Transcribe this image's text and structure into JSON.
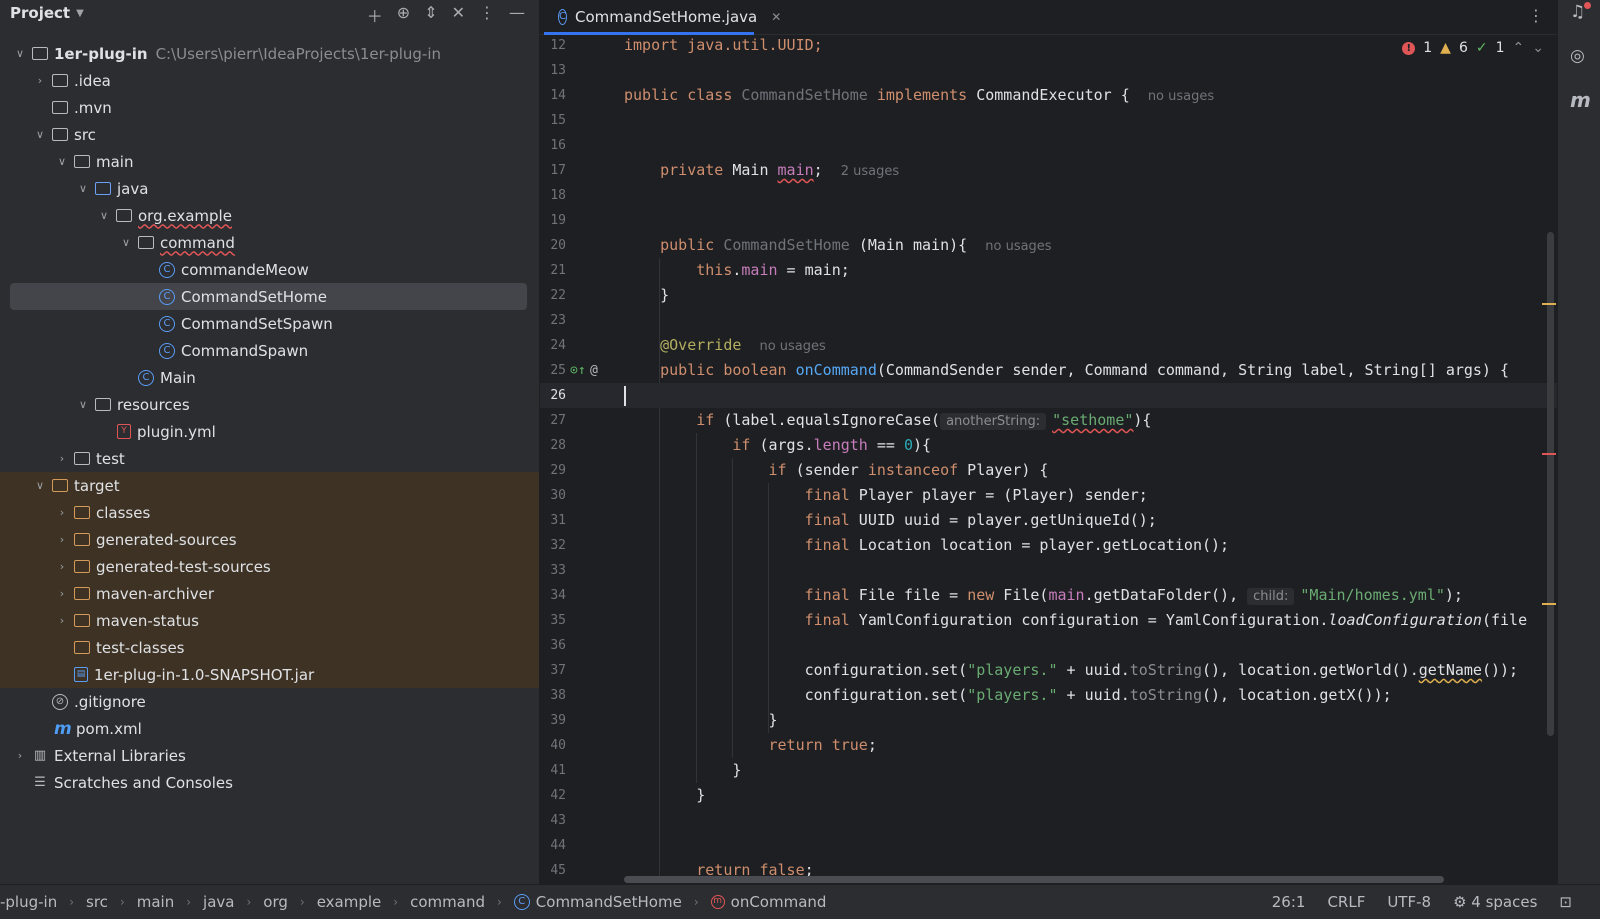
{
  "project_panel": {
    "title": "Project",
    "tree": [
      {
        "label": "1er-plug-in",
        "path": "C:\\Users\\pierr\\IdeaProjects\\1er-plug-in"
      },
      {
        "label": ".idea"
      },
      {
        "label": ".mvn"
      },
      {
        "label": "src"
      },
      {
        "label": "main"
      },
      {
        "label": "java"
      },
      {
        "label": "org.example"
      },
      {
        "label": "command"
      },
      {
        "label": "commandeMeow"
      },
      {
        "label": "CommandSetHome"
      },
      {
        "label": "CommandSetSpawn"
      },
      {
        "label": "CommandSpawn"
      },
      {
        "label": "Main"
      },
      {
        "label": "resources"
      },
      {
        "label": "plugin.yml"
      },
      {
        "label": "test"
      },
      {
        "label": "target"
      },
      {
        "label": "classes"
      },
      {
        "label": "generated-sources"
      },
      {
        "label": "generated-test-sources"
      },
      {
        "label": "maven-archiver"
      },
      {
        "label": "maven-status"
      },
      {
        "label": "test-classes"
      },
      {
        "label": "1er-plug-in-1.0-SNAPSHOT.jar"
      },
      {
        "label": ".gitignore"
      },
      {
        "label": "pom.xml"
      },
      {
        "label": "External Libraries"
      },
      {
        "label": "Scratches and Consoles"
      }
    ]
  },
  "editor": {
    "tab_label": "CommandSetHome.java",
    "inspections": {
      "errors": "1",
      "warnings": "6",
      "ok": "1"
    },
    "line_numbers": [
      "12",
      "13",
      "14",
      "15",
      "16",
      "17",
      "18",
      "19",
      "20",
      "21",
      "22",
      "23",
      "24",
      "25",
      "26",
      "27",
      "28",
      "29",
      "30",
      "31",
      "32",
      "33",
      "34",
      "35",
      "36",
      "37",
      "38",
      "39",
      "40",
      "41",
      "42",
      "43",
      "44",
      "45"
    ],
    "code": {
      "l12": "import java.util.UUID;",
      "l14_kw1": "public class",
      "l14_cls": "CommandSetHome",
      "l14_kw2": "implements",
      "l14_type": "CommandExecutor {",
      "l14_hint": "no usages",
      "l17_kw": "private",
      "l17_type": "Main",
      "l17_fld": "main",
      "l17_semi": ";",
      "l17_hint": "2 usages",
      "l20_kw": "public",
      "l20_cls": "CommandSetHome",
      "l20_rest": "(Main main){",
      "l20_hint": "no usages",
      "l21_kw": "this",
      "l21_dot": ".",
      "l21_fld": "main",
      "l21_rest": " = main;",
      "l22": "}",
      "l24_ann": "@Override",
      "l24_hint": "no usages",
      "l25_kw": "public boolean",
      "l25_fn": "onCommand",
      "l25_rest": "(CommandSender sender, Command command, String label, String[] args) {",
      "l27_kw": "if",
      "l27_a": " (label.equalsIgnoreCase(",
      "l27_hint": "anotherString:",
      "l27_str": "\"sethome\"",
      "l27_b": "){",
      "l28_kw": "if",
      "l28_a": " (args.",
      "l28_fld": "length",
      "l28_b": " == ",
      "l28_num": "0",
      "l28_c": "){",
      "l29_kw": "if",
      "l29_a": " (sender ",
      "l29_kw2": "instanceof",
      "l29_b": " Player) {",
      "l30_kw": "final",
      "l30_rest": " Player player = (Player) sender;",
      "l31_kw": "final",
      "l31_rest": " UUID uuid = player.getUniqueId();",
      "l32_kw": "final",
      "l32_rest": " Location location = player.getLocation();",
      "l34_kw": "final",
      "l34_a": " File file = ",
      "l34_kw2": "new",
      "l34_b": " File(",
      "l34_fld": "main",
      "l34_c": ".getDataFolder(),",
      "l34_hint": "child:",
      "l34_str": "\"Main/homes.yml\"",
      "l34_d": ");",
      "l35_kw": "final",
      "l35_a": " YamlConfiguration configuration = YamlConfiguration.",
      "l35_it": "loadConfiguration",
      "l35_b": "(file",
      "l37_a": "configuration.set(",
      "l37_str": "\"players.\"",
      "l37_b": " + uuid.",
      "l37_gray": "toString",
      "l37_c": "(), location.getWorld().",
      "l37_d": "getName",
      "l37_e": "());",
      "l38_a": "configuration.set(",
      "l38_str": "\"players.\"",
      "l38_b": " + uuid.",
      "l38_gray": "toString",
      "l38_c": "(), location.getX());",
      "l39": "}",
      "l40_kw": "return true",
      "l40_semi": ";",
      "l41": "}",
      "l42": "}",
      "l45_kw": "return false",
      "l45_semi": ";"
    }
  },
  "statusbar": {
    "breadcrumbs": [
      "-plug-in",
      "src",
      "main",
      "java",
      "org",
      "example",
      "command",
      "CommandSetHome",
      "onCommand"
    ],
    "position": "26:1",
    "line_ending": "CRLF",
    "encoding": "UTF-8",
    "indent": "4 spaces"
  },
  "icons": {
    "class": "C",
    "yml": "Y",
    "maven": "m",
    "notifications": "bell-icon",
    "ai_chat": "ai-chat-icon",
    "maven_tool": "maven-icon"
  },
  "colors": {
    "accent": "#3574f0",
    "excluded_bg": "#3d3223",
    "error": "#e05555",
    "warning": "#e0b050",
    "ok": "#5fb865"
  }
}
